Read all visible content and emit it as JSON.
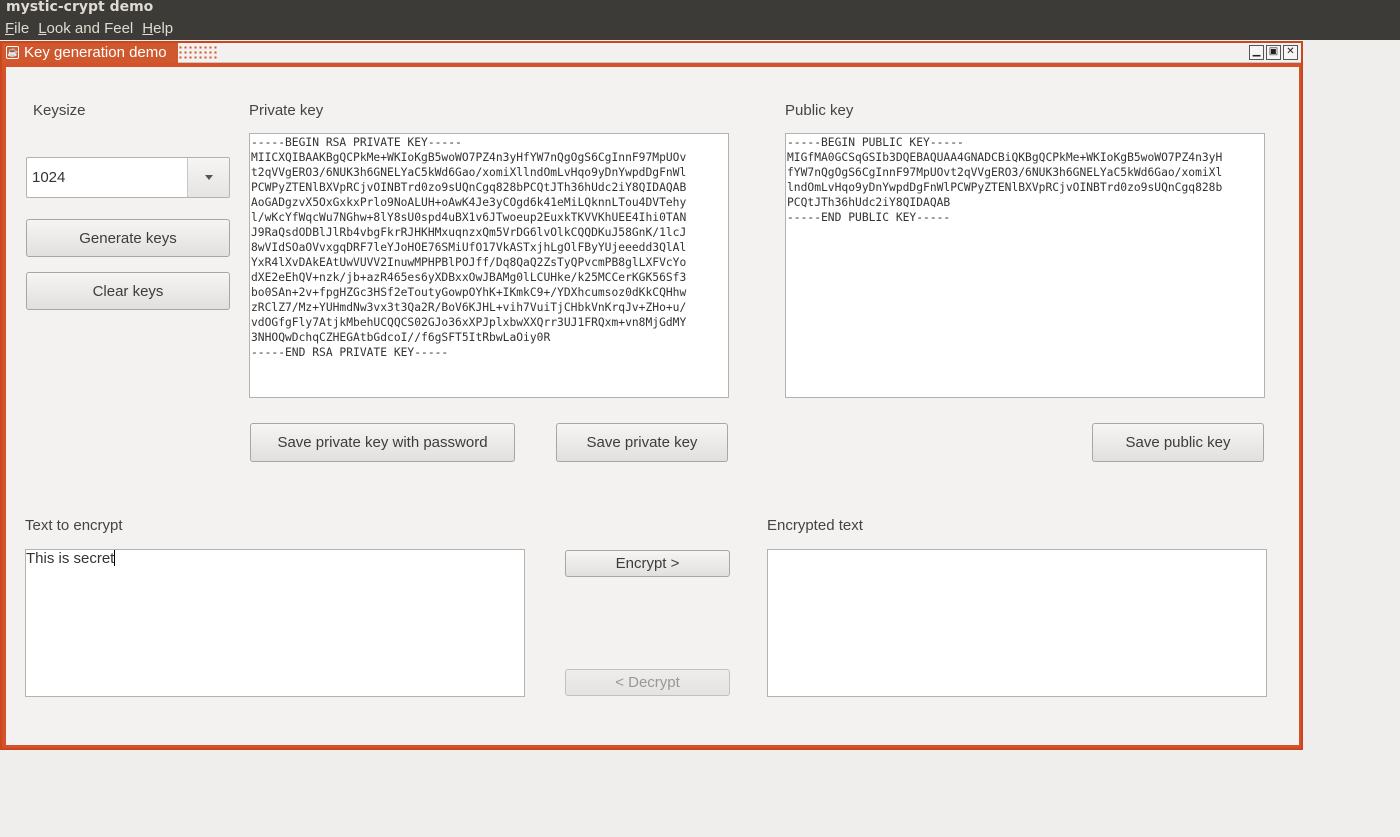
{
  "app": {
    "title": "mystic-crypt demo",
    "menu": [
      {
        "prefix": "",
        "mnemonic": "F",
        "rest": "ile"
      },
      {
        "prefix": "",
        "mnemonic": "L",
        "rest": "ook and Feel"
      },
      {
        "prefix": "",
        "mnemonic": "H",
        "rest": "elp"
      }
    ]
  },
  "frame": {
    "title": "Key generation demo",
    "controls": {
      "minimize": "▁",
      "maximize": "▣",
      "close": "✕"
    }
  },
  "keysize": {
    "label": "Keysize",
    "value": "1024",
    "dropdown_icon": "chevron-down-icon"
  },
  "buttons": {
    "generate": "Generate keys",
    "clear": "Clear keys",
    "save_private_password": "Save private key with password",
    "save_private": "Save private key",
    "save_public": "Save public key",
    "encrypt": "Encrypt >",
    "decrypt": "< Decrypt"
  },
  "private_key": {
    "label": "Private key",
    "text": "-----BEGIN RSA PRIVATE KEY-----\nMIICXQIBAAKBgQCPkMe+WKIoKgB5woWO7PZ4n3yHfYW7nQgOgS6CgInnF97MpUOv\nt2qVVgERO3/6NUK3h6GNELYaC5kWd6Gao/xomiXllndOmLvHqo9yDnYwpdDgFnWl\nPCWPyZTENlBXVpRCjvOINBTrd0zo9sUQnCgq828bPCQtJTh36hUdc2iY8QIDAQAB\nAoGADgzvX5OxGxkxPrlo9NoALUH+oAwK4Je3yCOgd6k41eMiLQknnLTou4DVTehy\nl/wKcYfWqcWu7NGhw+8lY8sU0spd4uBX1v6JTwoeup2EuxkTKVVKhUEE4Ihi0TAN\nJ9RaQsdODBlJlRb4vbgFkrRJHKHMxuqnzxQm5VrDG6lvOlkCQQDKuJ58GnK/1lcJ\n8wVIdSOaOVvxgqDRF7leYJoHOE76SMiUfO17VkASTxjhLgOlFByYUjeeedd3QlAl\nYxR4lXvDAkEAtUwVUVV2InuwMPHPBlPOJff/Dq8QaQ2ZsTyQPvcmPB8glLXFVcYo\ndXE2eEhQV+nzk/jb+azR465es6yXDBxxOwJBAMg0lLCUHke/k25MCCerKGK56Sf3\nbo0SAn+2v+fpgHZGc3HSf2eToutyGowpOYhK+IKmkC9+/YDXhcumsoz0dKkCQHhw\nzRClZ7/Mz+YUHmdNw3vx3t3Qa2R/BoV6KJHL+vih7VuiTjCHbkVnKrqJv+ZHo+u/\nvdOGfgFly7AtjkMbehUCQQCS02GJo36xXPJplxbwXXQrr3UJ1FRQxm+vn8MjGdMY\n3NHOQwDchqCZHEGAtbGdcoI//f6gSFT5ItRbwLaOiy0R\n-----END RSA PRIVATE KEY-----"
  },
  "public_key": {
    "label": "Public key",
    "text": "-----BEGIN PUBLIC KEY-----\nMIGfMA0GCSqGSIb3DQEBAQUAA4GNADCBiQKBgQCPkMe+WKIoKgB5woWO7PZ4n3yH\nfYW7nQgOgS6CgInnF97MpUOvt2qVVgERO3/6NUK3h6GNELYaC5kWd6Gao/xomiXl\nlndOmLvHqo9yDnYwpdDgFnWlPCWPyZTENlBXVpRCjvOINBTrd0zo9sUQnCgq828b\nPCQtJTh36hUdc2iY8QIDAQAB\n-----END PUBLIC KEY-----"
  },
  "plaintext": {
    "label": "Text to encrypt",
    "value": "This is secret"
  },
  "ciphertext": {
    "label": "Encrypted text",
    "value": ""
  }
}
